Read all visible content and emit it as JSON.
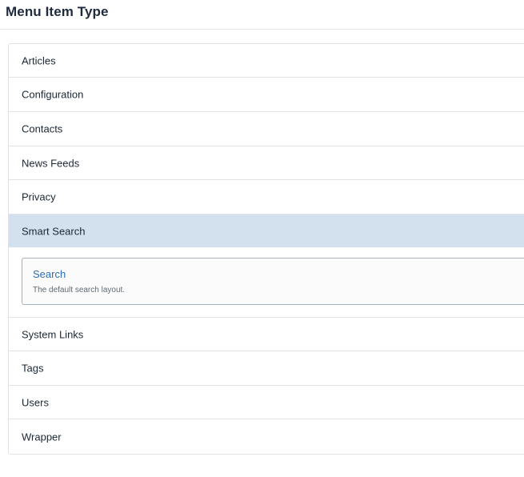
{
  "modal": {
    "title": "Menu Item Type"
  },
  "accordion": {
    "items": [
      {
        "label": "Articles"
      },
      {
        "label": "Configuration"
      },
      {
        "label": "Contacts"
      },
      {
        "label": "News Feeds"
      },
      {
        "label": "Privacy"
      },
      {
        "label": "Smart Search"
      },
      {
        "label": "System Links"
      },
      {
        "label": "Tags"
      },
      {
        "label": "Users"
      },
      {
        "label": "Wrapper"
      }
    ],
    "expanded_item": "Smart Search",
    "expanded_options": [
      {
        "title": "Search",
        "description": "The default search layout."
      }
    ]
  },
  "colors": {
    "active_background": "#d3e1ef",
    "link": "#2c6cb8",
    "border": "#dfe3e8"
  }
}
